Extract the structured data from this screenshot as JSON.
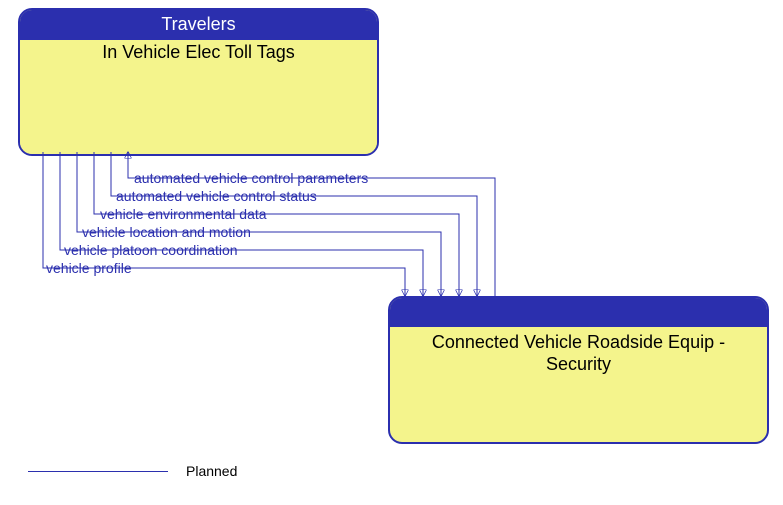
{
  "source_box": {
    "header": "Travelers",
    "subheader": "In Vehicle Elec Toll Tags"
  },
  "dest_box": {
    "title_line1": "Connected Vehicle Roadside Equip -",
    "title_line2": "Security"
  },
  "flows": [
    {
      "label": "automated vehicle control parameters",
      "direction": "to_source"
    },
    {
      "label": "automated vehicle control status",
      "direction": "to_dest"
    },
    {
      "label": "vehicle environmental data",
      "direction": "to_dest"
    },
    {
      "label": "vehicle location and motion",
      "direction": "to_dest"
    },
    {
      "label": "vehicle platoon coordination",
      "direction": "to_dest"
    },
    {
      "label": "vehicle profile",
      "direction": "to_dest"
    }
  ],
  "legend": {
    "label": "Planned"
  },
  "chart_data": {
    "type": "diagram",
    "nodes": [
      {
        "id": "travelers",
        "title": "Travelers",
        "subtitle": "In Vehicle Elec Toll Tags"
      },
      {
        "id": "cvrse",
        "title": "Connected Vehicle Roadside Equip - Security"
      }
    ],
    "edges": [
      {
        "from": "cvrse",
        "to": "travelers",
        "label": "automated vehicle control parameters",
        "status": "Planned"
      },
      {
        "from": "travelers",
        "to": "cvrse",
        "label": "automated vehicle control status",
        "status": "Planned"
      },
      {
        "from": "travelers",
        "to": "cvrse",
        "label": "vehicle environmental data",
        "status": "Planned"
      },
      {
        "from": "travelers",
        "to": "cvrse",
        "label": "vehicle location and motion",
        "status": "Planned"
      },
      {
        "from": "travelers",
        "to": "cvrse",
        "label": "vehicle platoon coordination",
        "status": "Planned"
      },
      {
        "from": "travelers",
        "to": "cvrse",
        "label": "vehicle profile",
        "status": "Planned"
      }
    ],
    "legend": [
      {
        "style": "solid-blue-line",
        "meaning": "Planned"
      }
    ]
  }
}
